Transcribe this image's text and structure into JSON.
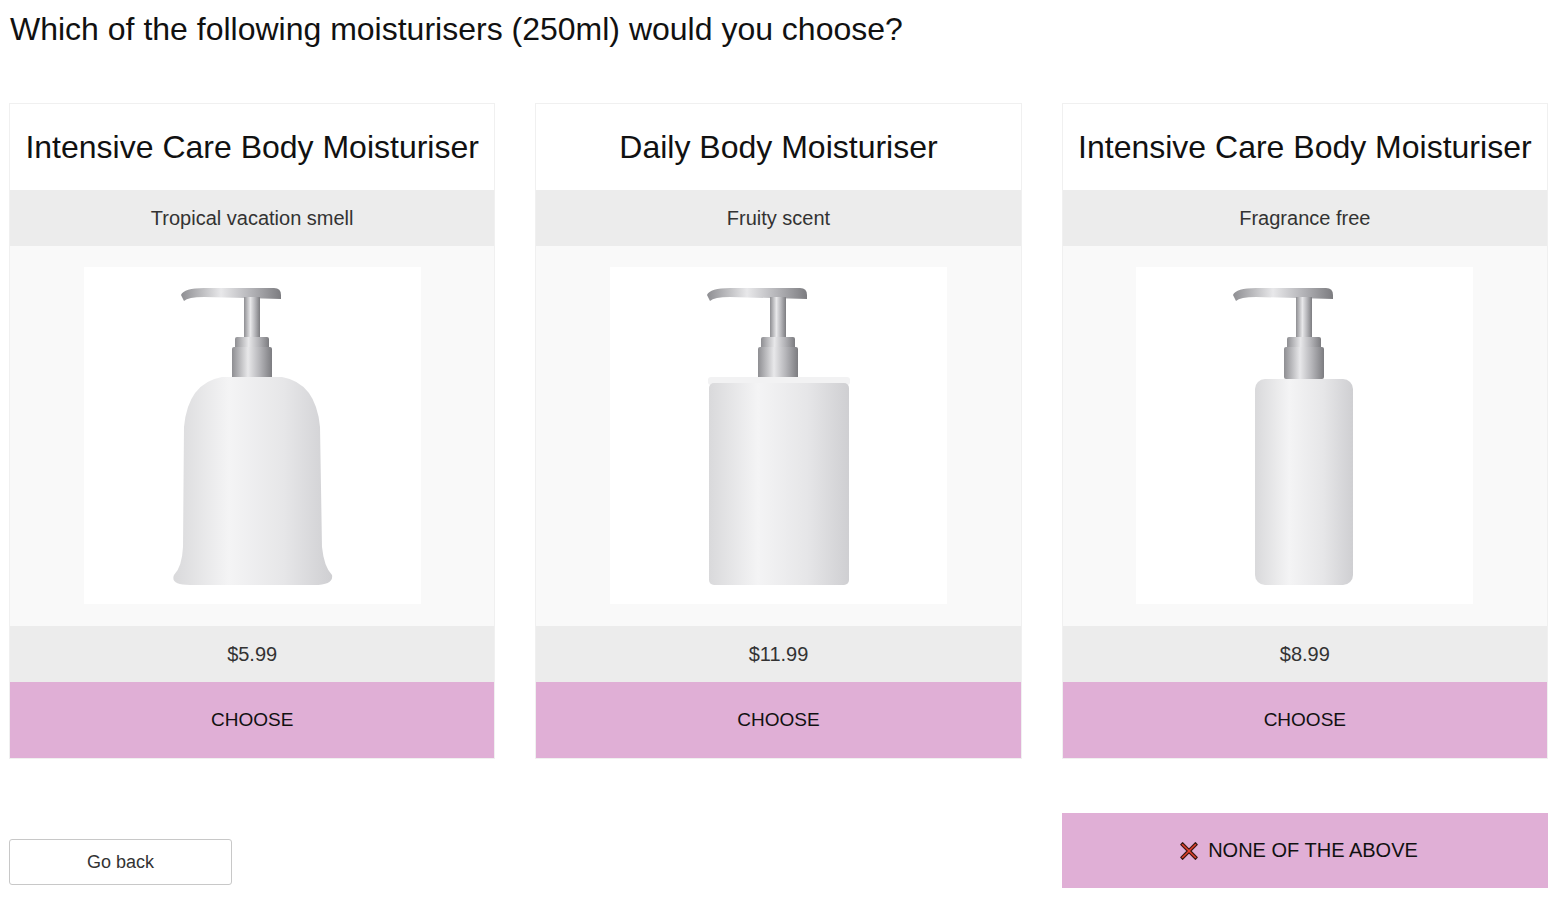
{
  "question": "Which of the following moisturisers (250ml) would you choose?",
  "products": [
    {
      "name": "Intensive Care Body Moisturiser",
      "scent": "Tropical vacation smell",
      "price": "$5.99",
      "kind": "bell",
      "button": "CHOOSE"
    },
    {
      "name": "Daily Body Moisturiser",
      "scent": "Fruity scent",
      "price": "$11.99",
      "kind": "square",
      "button": "CHOOSE"
    },
    {
      "name": "Intensive Care Body Moisturiser",
      "scent": "Fragrance free",
      "price": "$8.99",
      "kind": "cylinder",
      "button": "CHOOSE"
    }
  ],
  "back_button": "Go back",
  "none_button": "NONE OF THE ABOVE"
}
